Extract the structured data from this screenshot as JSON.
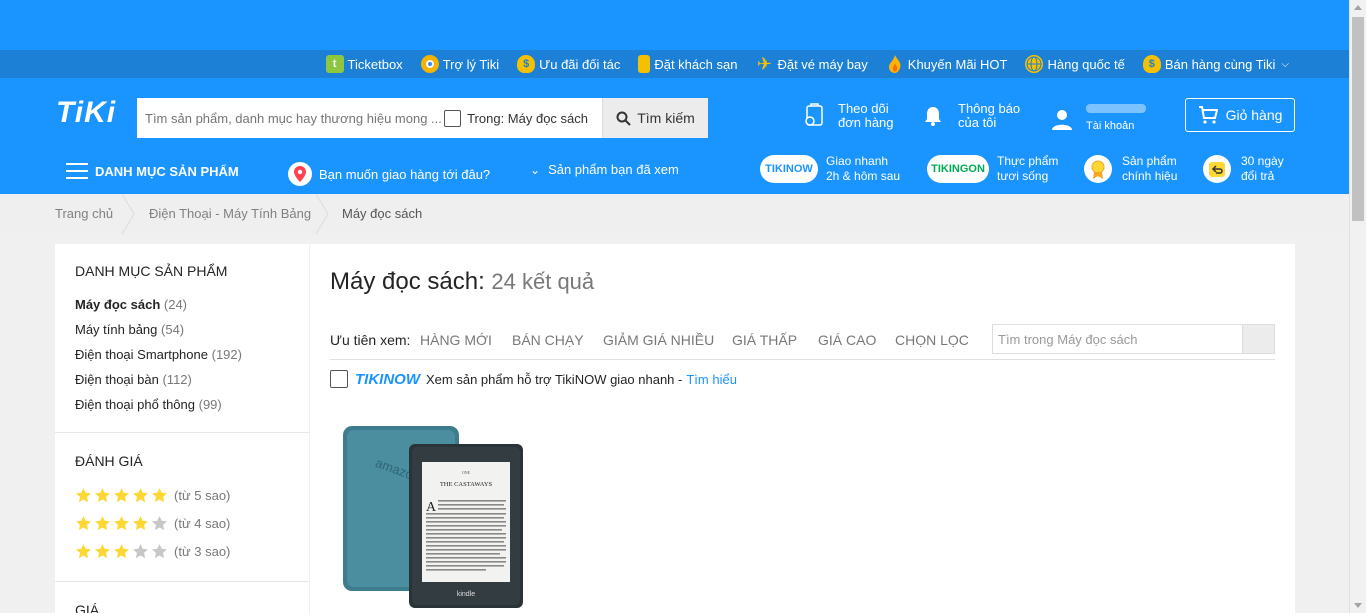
{
  "topbar": {
    "links": [
      {
        "label": "Ticketbox",
        "icon": "ticketbox-icon",
        "color": "#8dc63f"
      },
      {
        "label": "Trợ lý Tiki",
        "icon": "chrome-icon",
        "color": "#f4b400"
      },
      {
        "label": "Ưu đãi đối tác",
        "icon": "money-bag-icon",
        "color": "#f5c000"
      },
      {
        "label": "Đặt khách sạn",
        "icon": "hotel-icon",
        "color": "#f5c000"
      },
      {
        "label": "Đặt vé máy bay",
        "icon": "plane-icon",
        "color": "#f5c000"
      },
      {
        "label": "Khuyến Mãi HOT",
        "icon": "flame-icon",
        "color": "#ffb300"
      },
      {
        "label": "Hàng quốc tế",
        "icon": "globe-icon",
        "color": "#f5c000"
      },
      {
        "label": "Bán hàng cùng Tiki",
        "icon": "sell-bag-icon",
        "color": "#f5c000"
      }
    ]
  },
  "header": {
    "logo": "TiKi",
    "search_placeholder": "Tìm sản phẩm, danh mục hay thương hiệu mong ...",
    "scope_label": "Trong: Máy đọc sách",
    "search_button": "Tìm kiếm",
    "track_line1": "Theo dõi",
    "track_line2": "đơn hàng",
    "notify_line1": "Thông báo",
    "notify_line2": "của tôi",
    "account_label": "Tài khoản",
    "cart_label": "Giỏ hàng"
  },
  "nav": {
    "categories": "DANH MỤC SẢN PHẨM",
    "location": "Bạn muốn giao hàng tới đâu?",
    "viewed": "Sản phẩm bạn đã xem",
    "badges": [
      {
        "pill": "TIKINOW",
        "line1": "Giao nhanh",
        "line2": "2h & hôm sau"
      },
      {
        "pill": "TIKINGON",
        "line1": "Thực phẩm",
        "line2": "tươi sống"
      },
      {
        "line1": "Sản phẩm",
        "line2": "chính hiệu"
      },
      {
        "line1": "30 ngày",
        "line2": "đổi trả"
      }
    ]
  },
  "breadcrumb": [
    "Trang chủ",
    "Điện Thoại - Máy Tính Bảng",
    "Máy đọc sách"
  ],
  "sidebar": {
    "categories_title": "DANH MỤC SẢN PHẨM",
    "categories": [
      {
        "name": "Máy đọc sách",
        "count": "(24)"
      },
      {
        "name": "Máy tính bảng",
        "count": "(54)"
      },
      {
        "name": "Điện thoại Smartphone",
        "count": "(192)"
      },
      {
        "name": "Điện thoại bàn",
        "count": "(112)"
      },
      {
        "name": "Điện thoại phổ thông",
        "count": "(99)"
      }
    ],
    "rating_title": "ĐÁNH GIÁ",
    "ratings": [
      {
        "stars": 5,
        "label": "(từ 5 sao)"
      },
      {
        "stars": 4,
        "label": "(từ 4 sao)"
      },
      {
        "stars": 3,
        "label": "(từ 3 sao)"
      }
    ],
    "price_title": "GIÁ"
  },
  "main": {
    "title": "Máy đọc sách:",
    "result_count": "24 kết quả",
    "sort_label": "Ưu tiên xem:",
    "sort_options": [
      "HÀNG MỚI",
      "BÁN CHẠY",
      "GIẢM GIÁ NHIỀU",
      "GIÁ THẤP",
      "GIÁ CAO",
      "CHỌN LỌC"
    ],
    "search_in_placeholder": "Tìm trong Máy đọc sách",
    "tikinow_logo": "TIKINOW",
    "tikinow_text": "Xem sản phẩm hỗ trợ TikiNOW giao nhanh -",
    "tikinow_more": "Tìm hiểu",
    "product_cover_ch": "ONE",
    "product_cover_title": "THE CASTAWAYS",
    "product_brand": "kindle"
  },
  "colors": {
    "brand_blue": "#1a94ff",
    "topbar_blue": "#1b80d6",
    "star": "#fdd835",
    "star_empty": "#c7c7c7"
  }
}
